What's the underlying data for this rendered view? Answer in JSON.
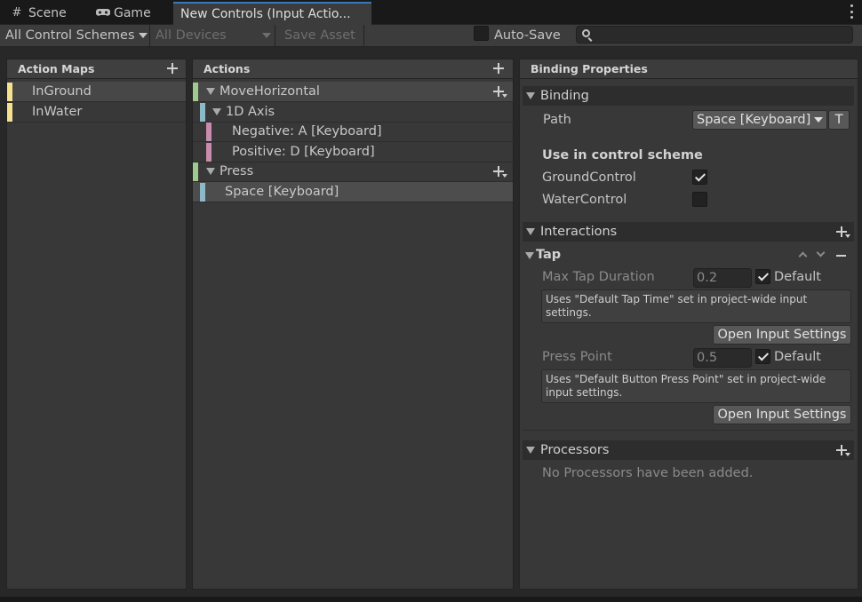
{
  "tabs": [
    {
      "label": "Scene",
      "icon": "grid-icon"
    },
    {
      "label": "Game",
      "icon": "gamepad-icon"
    },
    {
      "label": "New Controls (Input Actio..."
    }
  ],
  "toolbar": {
    "control_scheme": "All Control Schemes",
    "devices": "All Devices",
    "save_asset": "Save Asset",
    "auto_save": "Auto-Save",
    "auto_save_checked": false,
    "search_placeholder": ""
  },
  "action_maps": {
    "header": "Action Maps",
    "items": [
      {
        "label": "InGround",
        "color": "#f6e28e"
      },
      {
        "label": "InWater",
        "color": "#f6e28e"
      }
    ]
  },
  "actions": {
    "header": "Actions",
    "items": [
      {
        "label": "MoveHorizontal",
        "type": "action",
        "color": "#9ecb8c"
      },
      {
        "label": "1D Axis",
        "type": "composite",
        "color": "#8cb8c8"
      },
      {
        "label": "Negative: A [Keyboard]",
        "type": "part",
        "color": "#c88cae"
      },
      {
        "label": "Positive: D [Keyboard]",
        "type": "part",
        "color": "#c88cae"
      },
      {
        "label": "Press",
        "type": "action",
        "color": "#9ecb8c"
      },
      {
        "label": "Space [Keyboard]",
        "type": "binding",
        "color": "#8cb8c8"
      }
    ]
  },
  "binding_properties": {
    "header": "Binding Properties",
    "binding_section": "Binding",
    "path_label": "Path",
    "path_value": "Space [Keyboard]",
    "t_button": "T",
    "scheme_title": "Use in control scheme",
    "schemes": [
      {
        "label": "GroundControl",
        "checked": true
      },
      {
        "label": "WaterControl",
        "checked": false
      }
    ],
    "interactions_section": "Interactions",
    "tap": {
      "title": "Tap",
      "max_tap_label": "Max Tap Duration",
      "max_tap_value": "0.2",
      "default_label": "Default",
      "max_tap_help": "Uses \"Default Tap Time\" set in project-wide input settings.",
      "open_settings": "Open Input Settings",
      "press_point_label": "Press Point",
      "press_point_value": "0.5",
      "press_point_help": "Uses \"Default Button Press Point\" set in project-wide input settings."
    },
    "processors_section": "Processors",
    "processors_empty": "No Processors have been added."
  }
}
